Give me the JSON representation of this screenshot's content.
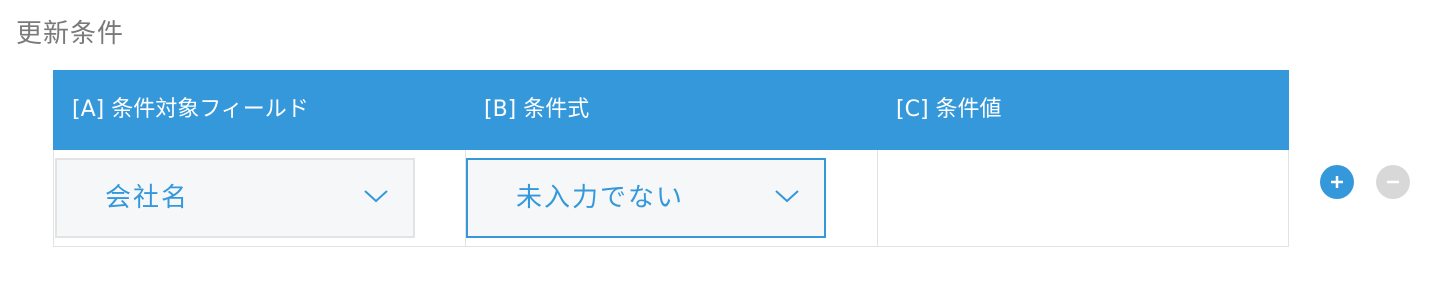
{
  "section": {
    "title": "更新条件"
  },
  "table": {
    "headers": {
      "field": "[A] 条件対象フィールド",
      "operator": "[B] 条件式",
      "value": "[C] 条件値"
    },
    "row": {
      "field_value": "会社名",
      "operator_value": "未入力でない",
      "condition_value": ""
    }
  },
  "icons": {
    "dropdown": "chevron-down-icon",
    "add": "plus-icon",
    "remove": "minus-icon"
  },
  "colors": {
    "accent": "#3498db",
    "select_background": "#f5f7f8",
    "border": "#e3e3e3",
    "title_text": "#7a7a7a",
    "remove_button": "#d8d8d8"
  }
}
